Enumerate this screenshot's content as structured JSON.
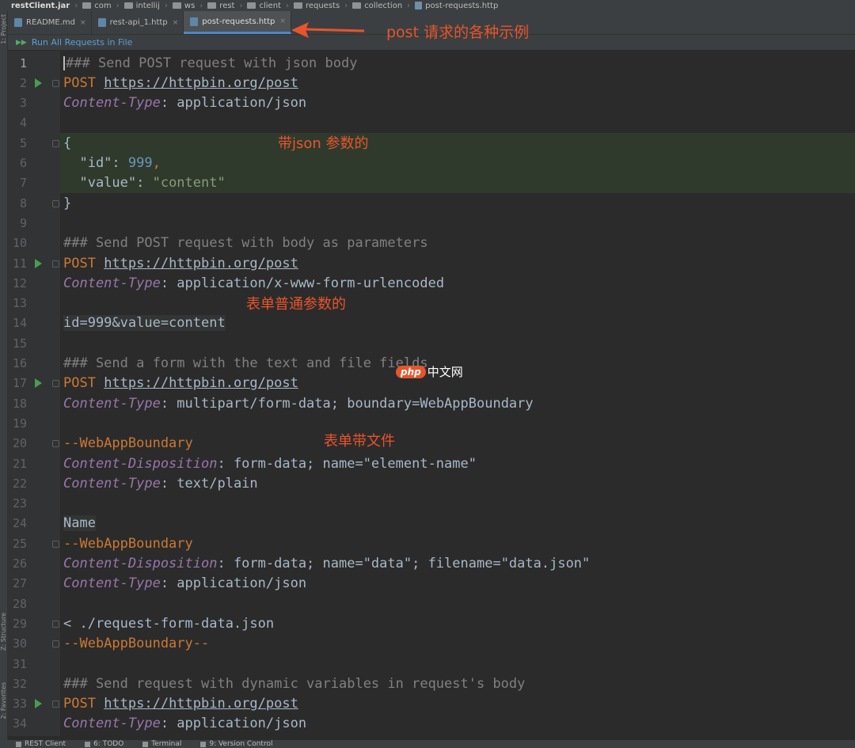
{
  "breadcrumb": [
    "restClient.jar",
    "com",
    "intellij",
    "ws",
    "rest",
    "client",
    "requests",
    "collection",
    "post-requests.http"
  ],
  "side_tabs": {
    "project": "1: Project",
    "structure": "Z: Structure",
    "favorites": "2: Favorites"
  },
  "tabs": [
    {
      "label": "README.md",
      "active": false
    },
    {
      "label": "rest-api_1.http",
      "active": false
    },
    {
      "label": "post-requests.http",
      "active": true
    }
  ],
  "run_all": "Run All Requests in File",
  "editor_lines": [
    {
      "n": "1",
      "run": false,
      "fold": false,
      "caret": true,
      "parts": [
        [
          "comment",
          "### Send POST request with json body"
        ]
      ]
    },
    {
      "n": "2",
      "run": true,
      "fold": true,
      "parts": [
        [
          "method",
          "POST "
        ],
        [
          "url",
          "https://httpbin.org/post"
        ]
      ]
    },
    {
      "n": "3",
      "run": false,
      "fold": false,
      "parts": [
        [
          "hkey",
          "Content-Type"
        ],
        [
          "plain",
          ": application/json"
        ]
      ]
    },
    {
      "n": "4",
      "run": false,
      "fold": false,
      "parts": []
    },
    {
      "n": "5",
      "run": false,
      "fold": true,
      "parts": [
        [
          "plain",
          "{"
        ]
      ]
    },
    {
      "n": "6",
      "run": false,
      "fold": false,
      "parts": [
        [
          "jkey",
          "  \"id\": "
        ],
        [
          "jnum",
          "999"
        ],
        [
          "method",
          ","
        ]
      ]
    },
    {
      "n": "7",
      "run": false,
      "fold": false,
      "parts": [
        [
          "jkey",
          "  \"value\": "
        ],
        [
          "jstr",
          "\"content\""
        ]
      ]
    },
    {
      "n": "8",
      "run": false,
      "fold": true,
      "parts": [
        [
          "plain",
          "}"
        ]
      ]
    },
    {
      "n": "9",
      "run": false,
      "fold": false,
      "parts": []
    },
    {
      "n": "10",
      "run": false,
      "fold": false,
      "parts": [
        [
          "comment",
          "### Send POST request with body as parameters"
        ]
      ]
    },
    {
      "n": "11",
      "run": true,
      "fold": true,
      "parts": [
        [
          "method",
          "POST "
        ],
        [
          "url",
          "https://httpbin.org/post"
        ]
      ]
    },
    {
      "n": "12",
      "run": false,
      "fold": false,
      "parts": [
        [
          "hkey",
          "Content-Type"
        ],
        [
          "plain",
          ": application/x-www-form-urlencoded"
        ]
      ]
    },
    {
      "n": "13",
      "run": false,
      "fold": false,
      "parts": []
    },
    {
      "n": "14",
      "run": false,
      "fold": false,
      "parts": [
        [
          "bodytxt",
          "id=999&value=content"
        ]
      ]
    },
    {
      "n": "15",
      "run": false,
      "fold": false,
      "parts": []
    },
    {
      "n": "16",
      "run": false,
      "fold": false,
      "parts": [
        [
          "comment",
          "### Send a form with the text and file fields"
        ]
      ]
    },
    {
      "n": "17",
      "run": true,
      "fold": true,
      "parts": [
        [
          "method",
          "POST "
        ],
        [
          "url",
          "https://httpbin.org/post"
        ]
      ]
    },
    {
      "n": "18",
      "run": false,
      "fold": false,
      "parts": [
        [
          "hkey",
          "Content-Type"
        ],
        [
          "plain",
          ": multipart/form-data; boundary=WebAppBoundary"
        ]
      ]
    },
    {
      "n": "19",
      "run": false,
      "fold": false,
      "parts": []
    },
    {
      "n": "20",
      "run": false,
      "fold": true,
      "parts": [
        [
          "bound",
          "--WebAppBoundary"
        ]
      ]
    },
    {
      "n": "21",
      "run": false,
      "fold": false,
      "parts": [
        [
          "hkey",
          "Content-Disposition"
        ],
        [
          "plain",
          ": form-data; name=\"element-name\""
        ]
      ]
    },
    {
      "n": "22",
      "run": false,
      "fold": false,
      "parts": [
        [
          "hkey",
          "Content-Type"
        ],
        [
          "plain",
          ": text/plain"
        ]
      ]
    },
    {
      "n": "23",
      "run": false,
      "fold": false,
      "parts": []
    },
    {
      "n": "24",
      "run": false,
      "fold": false,
      "parts": [
        [
          "bodytxt",
          "Name"
        ]
      ]
    },
    {
      "n": "25",
      "run": false,
      "fold": true,
      "parts": [
        [
          "bound",
          "--WebAppBoundary"
        ]
      ]
    },
    {
      "n": "26",
      "run": false,
      "fold": false,
      "parts": [
        [
          "hkey",
          "Content-Disposition"
        ],
        [
          "plain",
          ": form-data; name=\"data\"; filename=\"data.json\""
        ]
      ]
    },
    {
      "n": "27",
      "run": false,
      "fold": false,
      "parts": [
        [
          "hkey",
          "Content-Type"
        ],
        [
          "plain",
          ": application/json"
        ]
      ]
    },
    {
      "n": "28",
      "run": false,
      "fold": false,
      "parts": []
    },
    {
      "n": "29",
      "run": false,
      "fold": true,
      "parts": [
        [
          "plain",
          "< ./request-form-data.json"
        ]
      ]
    },
    {
      "n": "30",
      "run": false,
      "fold": true,
      "parts": [
        [
          "bound",
          "--WebAppBoundary--"
        ]
      ]
    },
    {
      "n": "31",
      "run": false,
      "fold": false,
      "parts": []
    },
    {
      "n": "32",
      "run": false,
      "fold": false,
      "parts": [
        [
          "comment",
          "### Send request with dynamic variables in request's body"
        ]
      ]
    },
    {
      "n": "33",
      "run": true,
      "fold": true,
      "parts": [
        [
          "method",
          "POST "
        ],
        [
          "url",
          "https://httpbin.org/post"
        ]
      ]
    },
    {
      "n": "34",
      "run": false,
      "fold": false,
      "parts": [
        [
          "hkey",
          "Content-Type"
        ],
        [
          "plain",
          ": application/json"
        ]
      ]
    }
  ],
  "annotations": {
    "post_examples": "post 请求的各种示例",
    "json_params": "带json 参数的",
    "form_params": "表单普通参数的",
    "form_file": "表单带文件"
  },
  "watermark": {
    "badge": "php",
    "text": "中文网"
  },
  "statusbar": [
    "REST Client",
    "6: TODO",
    "Terminal",
    "9: Version Control"
  ],
  "colors": {
    "annotation": "#e8542d",
    "accent": "#4a88c7",
    "run_icon": "#4a9c52"
  }
}
